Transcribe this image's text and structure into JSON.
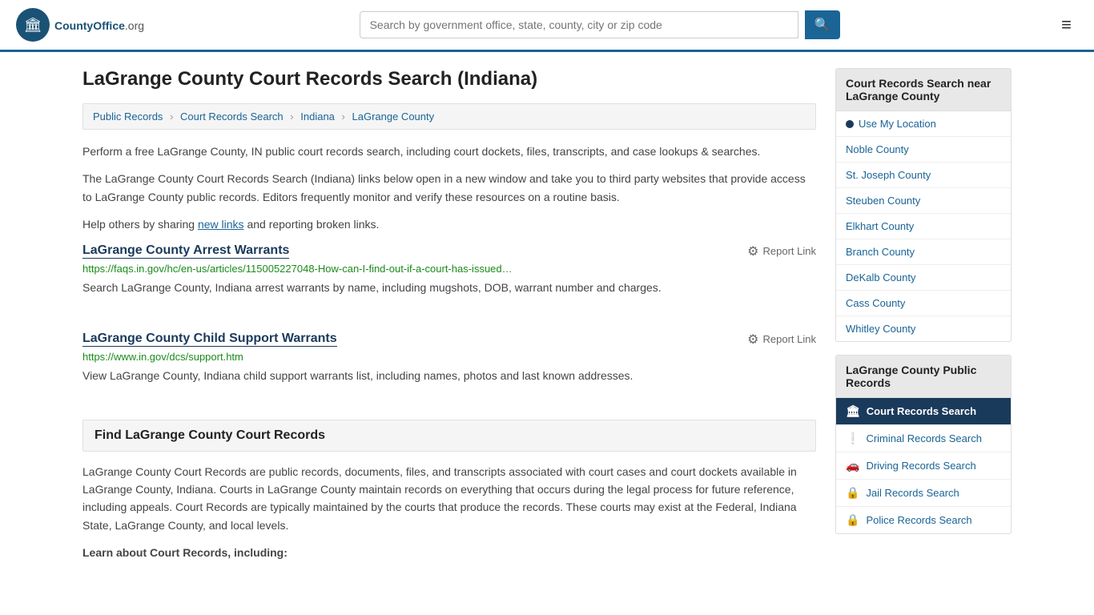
{
  "header": {
    "logo_text": "CountyOffice",
    "logo_suffix": ".org",
    "search_placeholder": "Search by government office, state, county, city or zip code",
    "search_btn_label": "🔍"
  },
  "page": {
    "title": "LaGrange County Court Records Search (Indiana)",
    "breadcrumbs": [
      {
        "label": "Public Records",
        "href": "#"
      },
      {
        "label": "Court Records Search",
        "href": "#"
      },
      {
        "label": "Indiana",
        "href": "#"
      },
      {
        "label": "LaGrange County",
        "href": "#"
      }
    ],
    "description1": "Perform a free LaGrange County, IN public court records search, including court dockets, files, transcripts, and case lookups & searches.",
    "description2": "The LaGrange County Court Records Search (Indiana) links below open in a new window and take you to third party websites that provide access to LaGrange County public records. Editors frequently monitor and verify these resources on a routine basis.",
    "description3_pre": "Help others by sharing ",
    "description3_link": "new links",
    "description3_post": " and reporting broken links.",
    "links": [
      {
        "title": "LaGrange County Arrest Warrants",
        "url": "https://faqs.in.gov/hc/en-us/articles/115005227048-How-can-I-find-out-if-a-court-has-issued…",
        "description": "Search LaGrange County, Indiana arrest warrants by name, including mugshots, DOB, warrant number and charges.",
        "report_label": "Report Link"
      },
      {
        "title": "LaGrange County Child Support Warrants",
        "url": "https://www.in.gov/dcs/support.htm",
        "description": "View LaGrange County, Indiana child support warrants list, including names, photos and last known addresses.",
        "report_label": "Report Link"
      }
    ],
    "section_title": "Find LaGrange County Court Records",
    "section_body": "LaGrange County Court Records are public records, documents, files, and transcripts associated with court cases and court dockets available in LaGrange County, Indiana. Courts in LaGrange County maintain records on everything that occurs during the legal process for future reference, including appeals. Court Records are typically maintained by the courts that produce the records. These courts may exist at the Federal, Indiana State, LaGrange County, and local levels.",
    "learn_about": "Learn about Court Records, including:"
  },
  "sidebar": {
    "nearby_title": "Court Records Search near LaGrange County",
    "use_location": "Use My Location",
    "nearby_counties": [
      {
        "label": "Noble County",
        "href": "#"
      },
      {
        "label": "St. Joseph County",
        "href": "#"
      },
      {
        "label": "Steuben County",
        "href": "#"
      },
      {
        "label": "Elkhart County",
        "href": "#"
      },
      {
        "label": "Branch County",
        "href": "#"
      },
      {
        "label": "DeKalb County",
        "href": "#"
      },
      {
        "label": "Cass County",
        "href": "#"
      },
      {
        "label": "Whitley County",
        "href": "#"
      }
    ],
    "public_records_title": "LaGrange County Public Records",
    "public_records_items": [
      {
        "label": "Court Records Search",
        "icon": "🏛",
        "active": true
      },
      {
        "label": "Criminal Records Search",
        "icon": "❕",
        "active": false
      },
      {
        "label": "Driving Records Search",
        "icon": "🚗",
        "active": false
      },
      {
        "label": "Jail Records Search",
        "icon": "🔒",
        "active": false
      },
      {
        "label": "Police Records Search",
        "icon": "🔒",
        "active": false
      }
    ]
  }
}
